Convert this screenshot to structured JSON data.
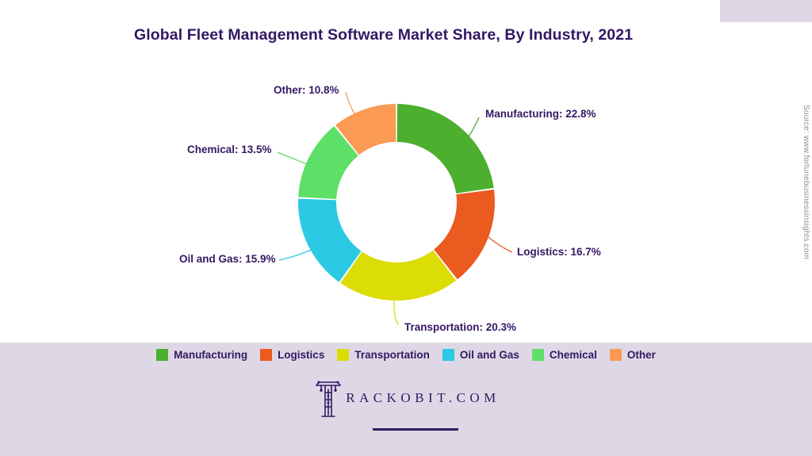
{
  "chart_data": {
    "type": "pie",
    "variant": "donut",
    "title": "Global Fleet Management Software Market Share, By Industry, 2021",
    "xlabel": "",
    "ylabel": "",
    "units": "percent",
    "legend_position": "bottom",
    "grid": false,
    "start_angle_deg": 0,
    "direction": "clockwise",
    "categories": [
      "Manufacturing",
      "Logistics",
      "Transportation",
      "Oil and Gas",
      "Chemical",
      "Other"
    ],
    "values": [
      22.8,
      16.7,
      20.3,
      15.9,
      13.5,
      10.8
    ],
    "colors": [
      "#4CAF2E",
      "#EB5A1E",
      "#DCDC06",
      "#2BC9E3",
      "#5EE068",
      "#FB9A52"
    ],
    "labels": [
      "Manufacturing: 22.8%",
      "Logistics: 16.7%",
      "Transportation: 20.3%",
      "Oil and Gas: 15.9%",
      "Chemical: 13.5%",
      "Other: 10.8%"
    ]
  },
  "legend": {
    "items": [
      {
        "label": "Manufacturing",
        "color": "#4CAF2E"
      },
      {
        "label": "Logistics",
        "color": "#EB5A1E"
      },
      {
        "label": "Transportation",
        "color": "#DCDC06"
      },
      {
        "label": "Oil and Gas",
        "color": "#2BC9E3"
      },
      {
        "label": "Chemical",
        "color": "#5EE068"
      },
      {
        "label": "Other",
        "color": "#FB9A52"
      }
    ]
  },
  "footer": {
    "logo_wordmark": "RACKOBIT.COM",
    "logo_mark_letter": "T"
  },
  "source": {
    "text": "Source: www.fortunebusinessinsights.com"
  },
  "theme": {
    "text_color": "#331863",
    "band_color": "#DED8E6",
    "source_color": "#8F8F95",
    "background": "#FFFFFF"
  }
}
